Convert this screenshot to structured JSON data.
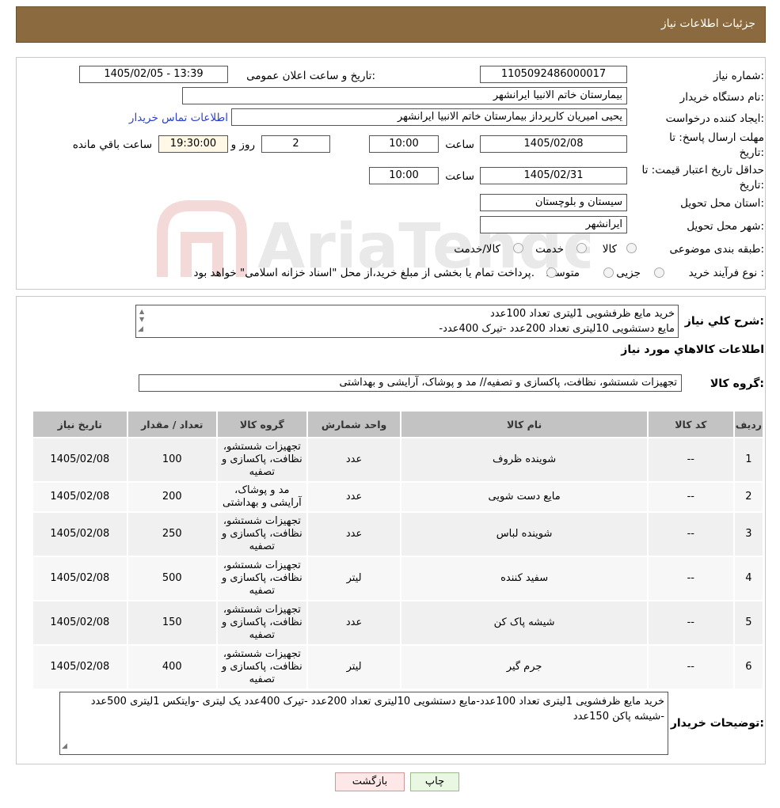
{
  "header": {
    "title": "جزئیات اطلاعات نیاز"
  },
  "form": {
    "need_number_label": "شماره نیاز:",
    "need_number": "1105092486000017",
    "announce_label": "تاریخ و ساعت اعلان عمومی:",
    "announce_value": "1405/02/05 - 13:39",
    "buyer_org_label": "نام دستگاه خریدار:",
    "buyer_org": "بیمارستان خاتم الانبیا ایرانشهر",
    "creator_label": "ایجاد کننده درخواست:",
    "creator": "یحیی امیریان کارپرداز بیمارستان خاتم الانبیا ایرانشهر",
    "contact_link": "اطلاعات تماس خریدار",
    "deadline_label": "مهلت ارسال پاسخ: تا تاریخ:",
    "deadline_date": "1405/02/08",
    "time_label": "ساعت",
    "deadline_time": "10:00",
    "days_value": "2",
    "days_label": "روز و",
    "remaining_time": "19:30:00",
    "remaining_label": "ساعت باقي مانده",
    "validity_label": "حداقل تاریخ اعتبار قیمت: تا تاریخ:",
    "validity_date": "1405/02/31",
    "validity_time": "10:00",
    "province_label": "استان محل تحویل:",
    "province": "سیستان و بلوچستان",
    "city_label": "شهر محل تحویل:",
    "city": "ایرانشهر",
    "category_label": "طبقه بندی موضوعی:",
    "category_options": [
      "کالا",
      "خدمت",
      "کالا/خدمت"
    ],
    "process_label": "نوع فرآیند خرید :",
    "process_options": [
      "جزیی",
      "متوسط"
    ],
    "process_note": "پرداخت تمام یا بخشی از مبلغ خرید،از محل \"اسناد خزانه اسلامی\" خواهد بود."
  },
  "summary": {
    "label": "شرح کلي نیاز:",
    "line1": "خرید مایع ظرفشویی 1لیتری تعداد 100عدد",
    "line2": "-مایع دستشویی 10لیتری تعداد 200عدد -تیرک 400عدد"
  },
  "goods": {
    "section_title": "اطلاعات کالاهاي مورد نیاز",
    "group_label": "گروه کالا:",
    "group_value": "تجهیزات شستشو، نظافت، پاکسازی و تصفیه// مد و پوشاک، آرایشی و بهداشتی"
  },
  "table": {
    "headers": [
      "ردیف",
      "کد کالا",
      "نام کالا",
      "واحد شمارش",
      "گروه کالا",
      "تعداد / مقدار",
      "تاریخ نیاز"
    ],
    "rows": [
      {
        "row": "1",
        "code": "--",
        "name": "شوینده ظروف",
        "unit": "عدد",
        "group": "تجهیزات شستشو، نظافت، پاکسازی و تصفیه",
        "qty": "100",
        "date": "1405/02/08"
      },
      {
        "row": "2",
        "code": "--",
        "name": "مایع دست شویی",
        "unit": "عدد",
        "group": "مد و پوشاک، آرایشی و بهداشتی",
        "qty": "200",
        "date": "1405/02/08"
      },
      {
        "row": "3",
        "code": "--",
        "name": "شوینده لباس",
        "unit": "عدد",
        "group": "تجهیزات شستشو، نظافت، پاکسازی و تصفیه",
        "qty": "250",
        "date": "1405/02/08"
      },
      {
        "row": "4",
        "code": "--",
        "name": "سفید کننده",
        "unit": "لیتر",
        "group": "تجهیزات شستشو، نظافت، پاکسازی و تصفیه",
        "qty": "500",
        "date": "1405/02/08"
      },
      {
        "row": "5",
        "code": "--",
        "name": "شیشه پاک کن",
        "unit": "عدد",
        "group": "تجهیزات شستشو، نظافت، پاکسازی و تصفیه",
        "qty": "150",
        "date": "1405/02/08"
      },
      {
        "row": "6",
        "code": "--",
        "name": "جرم گیر",
        "unit": "لیتر",
        "group": "تجهیزات شستشو، نظافت، پاکسازی و تصفیه",
        "qty": "400",
        "date": "1405/02/08"
      }
    ]
  },
  "buyer_notes": {
    "label": "توضیحات خریدار:",
    "text": "خرید مایع ظرفشویی 1لیتری تعداد 100عدد-مایع دستشویی 10لیتری تعداد 200عدد -تیرک 400عدد یک لیتری -وایتکس 1لیتری 500عدد -شیشه پاکن 150عدد"
  },
  "buttons": {
    "print": "چاپ",
    "back": "بازگشت"
  },
  "watermark": {
    "text": "AriaTender.neT"
  }
}
